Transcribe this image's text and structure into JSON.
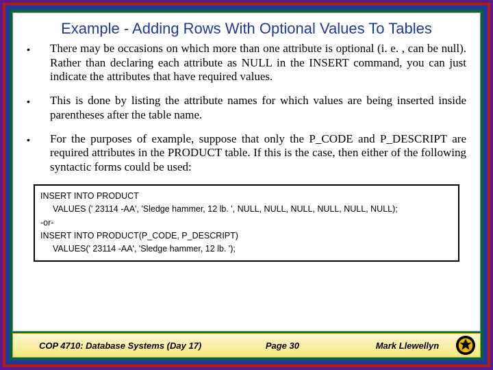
{
  "title": "Example - Adding Rows With Optional Values To Tables",
  "bullets": [
    "There may be occasions on which more than one attribute is optional (i. e. , can be null).  Rather than declaring each attribute as NULL in the INSERT command, you can just indicate the attributes that have required values.",
    "This is done by listing the attribute names for which values are being inserted inside parentheses after the table name.",
    "For the purposes of example, suppose that only the P_CODE and P_DESCRIPT are required attributes in the PRODUCT table.  If this is the case, then either of the following syntactic forms could be used:"
  ],
  "code": {
    "line1": "INSERT INTO PRODUCT",
    "line2": "VALUES (' 23114 -AA',  'Sledge hammer, 12 lb. ', NULL, NULL, NULL, NULL, NULL, NULL);",
    "line3": "-or-",
    "line4": "INSERT INTO PRODUCT(P_CODE, P_DESCRIPT)",
    "line5": "VALUES(' 23114 -AA', 'Sledge hammer, 12 lb. ');"
  },
  "footer": {
    "course": "COP 4710: Database Systems  (Day 17)",
    "page": "Page 30",
    "author": "Mark Llewellyn"
  }
}
